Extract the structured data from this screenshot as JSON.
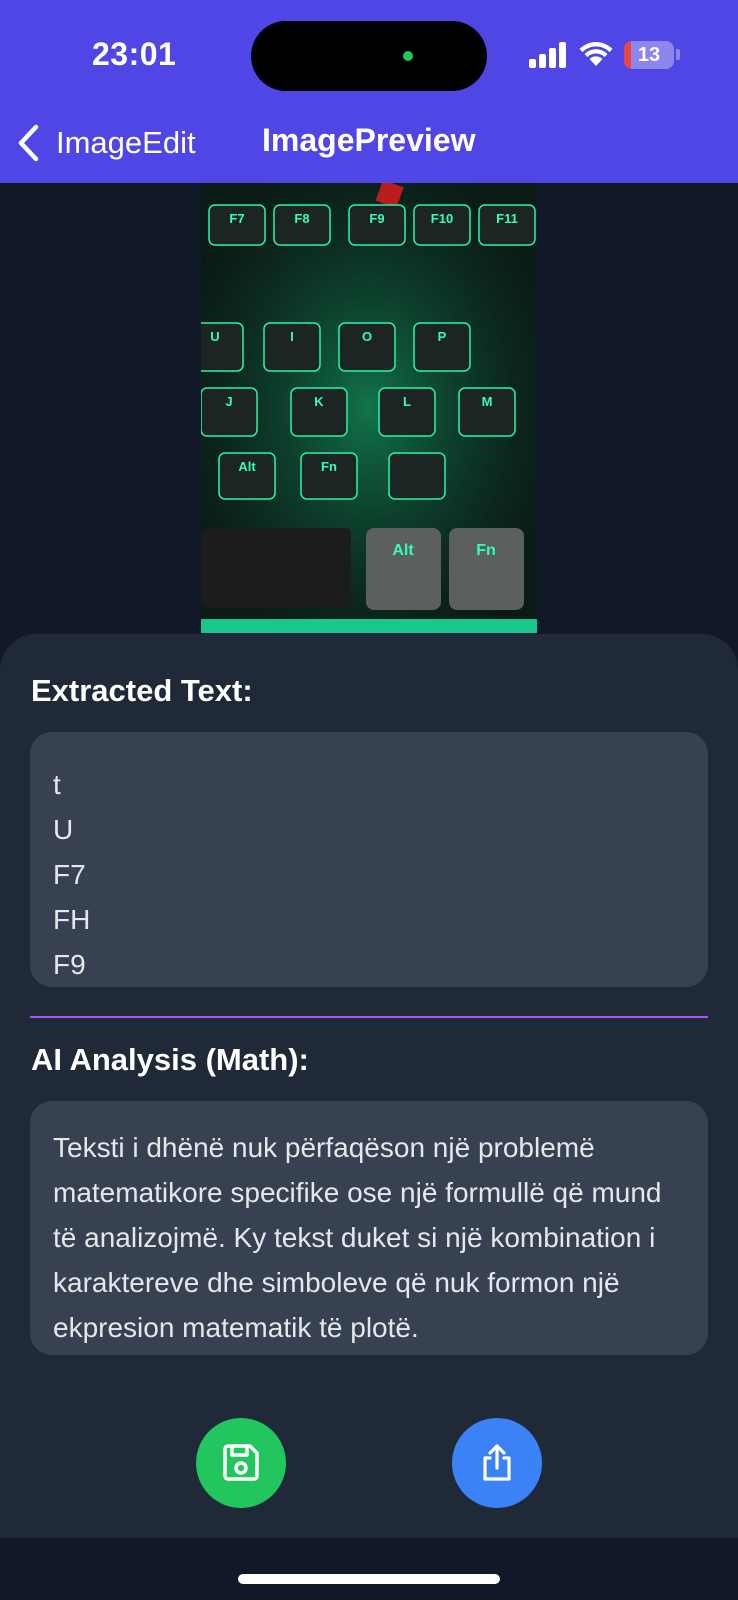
{
  "status_bar": {
    "time": "23:01",
    "battery_level": "13",
    "battery_fraction": 0.13,
    "accent_dot_color": "#22c55e"
  },
  "nav": {
    "back_label": "ImageEdit",
    "title": "ImagePreview",
    "background": "#4f46e5"
  },
  "preview": {
    "keycaps": [
      "F7",
      "F8",
      "F9",
      "F10",
      "F11",
      "U",
      "I",
      "O",
      "P",
      "J",
      "K",
      "L",
      "M",
      "Alt",
      "Fn"
    ]
  },
  "extracted": {
    "heading": "Extracted Text:",
    "lines": [
      "t",
      "U",
      "F7",
      "FH",
      "F9"
    ]
  },
  "analysis": {
    "heading": "AI Analysis (Math):",
    "text": "Teksti i dhënë nuk përfaqëson një problemë matematikore specifike ose një formullë që mund të analizojmë. Ky tekst duket si një kombination i karaktereve dhe simboleve që nuk formon një ekpresion matematik të plotë."
  },
  "actions": {
    "save_icon": "floppy-disk-icon",
    "share_icon": "share-icon",
    "save_color": "#22c55e",
    "share_color": "#3b82f6"
  }
}
